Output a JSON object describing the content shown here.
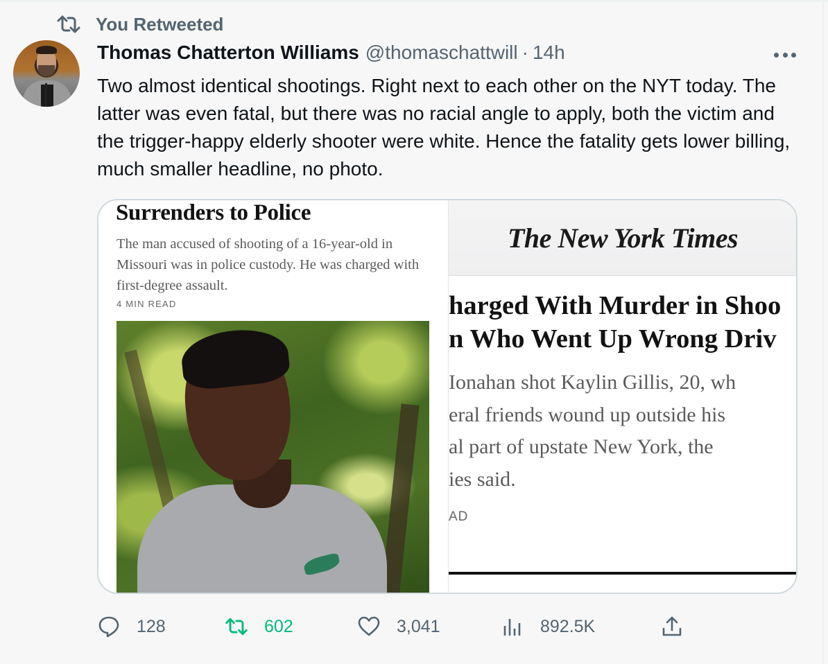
{
  "retweet_context": {
    "label": "You Retweeted",
    "icon": "retweet-icon"
  },
  "author": {
    "display_name": "Thomas Chatterton Williams",
    "handle": "@thomaschattwill",
    "separator": "·",
    "timestamp": "14h"
  },
  "tweet": {
    "text": "Two almost identical shootings. Right next to each other on the NYT today. The latter was even fatal, but there was no racial angle to apply, both the victim and the trigger-happy elderly shooter were white. Hence the fatality gets lower billing, much smaller headline, no photo."
  },
  "media": {
    "left": {
      "headline": "Surrenders to Police",
      "summary": "The man accused of shooting of a 16-year-old in Missouri was in police custody. He was charged with first-degree assault.",
      "read_time": "4 MIN READ"
    },
    "right": {
      "masthead": "The New York Times",
      "headline_lines": [
        "harged With Murder in Shoo",
        "n Who Went Up Wrong Driv"
      ],
      "summary_lines": [
        "Ionahan shot Kaylin Gillis, 20, wh",
        "eral friends wound up outside his",
        "al part of upstate New York, the",
        "ies said."
      ],
      "read_time": "AD"
    }
  },
  "actions": {
    "reply": {
      "icon": "reply-icon",
      "count": "128"
    },
    "retweet": {
      "icon": "retweet-icon",
      "count": "602",
      "active": true,
      "color": "#00ba7c"
    },
    "like": {
      "icon": "heart-icon",
      "count": "3,041"
    },
    "views": {
      "icon": "views-icon",
      "count": "892.5K"
    },
    "share": {
      "icon": "share-icon"
    }
  },
  "colors": {
    "text_primary": "#0f1419",
    "text_secondary": "#536471",
    "retweet_green": "#00ba7c",
    "border": "#cfd9de",
    "background": "#f7f7f7"
  }
}
